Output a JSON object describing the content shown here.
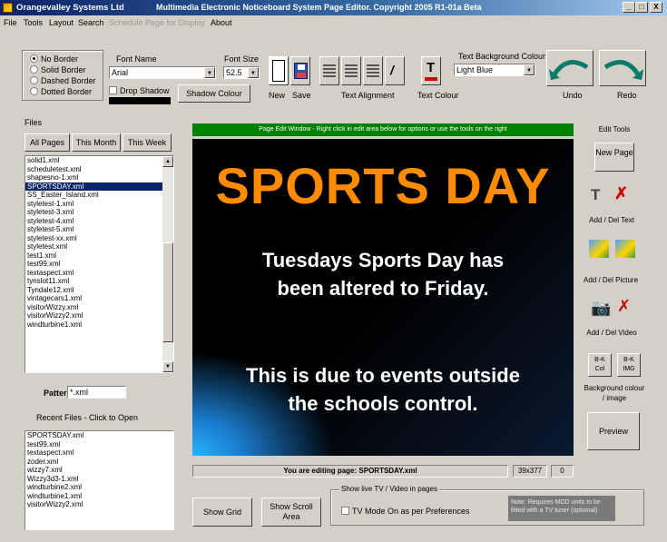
{
  "window": {
    "app_name": "Orangevalley Systems Ltd",
    "title": "Multimedia Electronic Noticeboard System Page Editor.  Copyright 2005 R1-01a Beta",
    "controls": [
      "_",
      "□",
      "X"
    ]
  },
  "menu": [
    "File",
    "Tools",
    "Layout",
    "Search",
    "Schedule Page for Display",
    "About"
  ],
  "border_options": {
    "items": [
      {
        "label": "No Border",
        "selected": true
      },
      {
        "label": "Solid Border",
        "selected": false
      },
      {
        "label": "Dashed Border",
        "selected": false
      },
      {
        "label": "Dotted Border",
        "selected": false
      }
    ]
  },
  "font": {
    "name_label": "Font Name",
    "name_value": "Arial",
    "size_label": "Font Size",
    "size_value": "52.5",
    "drop_shadow_label": "Drop Shadow",
    "shadow_colour_label": "Shadow Colour"
  },
  "toolbar_labels": {
    "new": "New",
    "save": "Save",
    "text_alignment": "Text Alignment",
    "text_colour": "Text Colour",
    "text_bg_label": "Text Background Colour",
    "text_bg_value": "Light Blue",
    "undo": "Undo",
    "redo": "Redo"
  },
  "files": {
    "label": "Files",
    "tabs": [
      "All Pages",
      "This Month",
      "This Week"
    ],
    "items": [
      "solid1.xml",
      "scheduletest.xml",
      "shapesno-1.xml",
      "SPORTSDAY.xml",
      "SS_Easter_Island.xml",
      "styletest-1.xml",
      "styletest-3.xml",
      "styletest-4.xml",
      "styletest-5.xml",
      "styletest-xx.xml",
      "styletest.xml",
      "test1.xml",
      "test99.xml",
      "textaspect.xml",
      "tynslot11.xml",
      "Tyndale12.xml",
      "vintagecars1.xml",
      "visitorWizzy.xml",
      "visitorWizzy2.xml",
      "windturbine1.xml"
    ],
    "selected_index": 3,
    "pattern_label": "Pattern",
    "pattern_value": "*.xml",
    "recent_label": "Recent Files - Click to Open",
    "recent_items": [
      "SPORTSDAY.xml",
      "test99.xml",
      "textaspect.xml",
      "zoder.xml",
      "wizzy7.xml",
      "Wizzy3d3-1.xml",
      "windturbine2.xml",
      "windturbine1.xml",
      "visitorWizzy2.xml"
    ]
  },
  "editor": {
    "header": "Page Edit Window - Right click in edit area below for options or use the tools on the right",
    "headline": "SPORTS DAY",
    "body1_line1": "Tuesdays Sports Day has",
    "body1_line2": "been altered to Friday.",
    "body2_line1": "This is due to events outside",
    "body2_line2": "the schools control.",
    "status": "You are editing page: SPORTSDAY.xml",
    "coords": "39x377",
    "counter": "0"
  },
  "bottom": {
    "show_grid": "Show Grid",
    "show_scroll_area": "Show Scroll Area",
    "tv_group_label": "Show live TV / Video in pages",
    "tv_mode_label": "TV Mode On as per Preferences",
    "tv_note": "Note: Requires MDD units to be fitted with a TV tuner (optional)"
  },
  "edit_tools": {
    "label": "Edit Tools",
    "new_page": "New Page",
    "add_del_text": "Add / Del Text",
    "add_del_picture": "Add / Del Picture",
    "add_del_video": "Add / Del Video",
    "bk_col": "B-K Col",
    "bk_img": "B-K IMG",
    "background_label": "Background colour / image",
    "preview": "Preview"
  },
  "colors": {
    "title_bar": "#0a246a",
    "headline": "#ff8c00",
    "edit_header": "#008000",
    "selection": "#0a246a"
  }
}
